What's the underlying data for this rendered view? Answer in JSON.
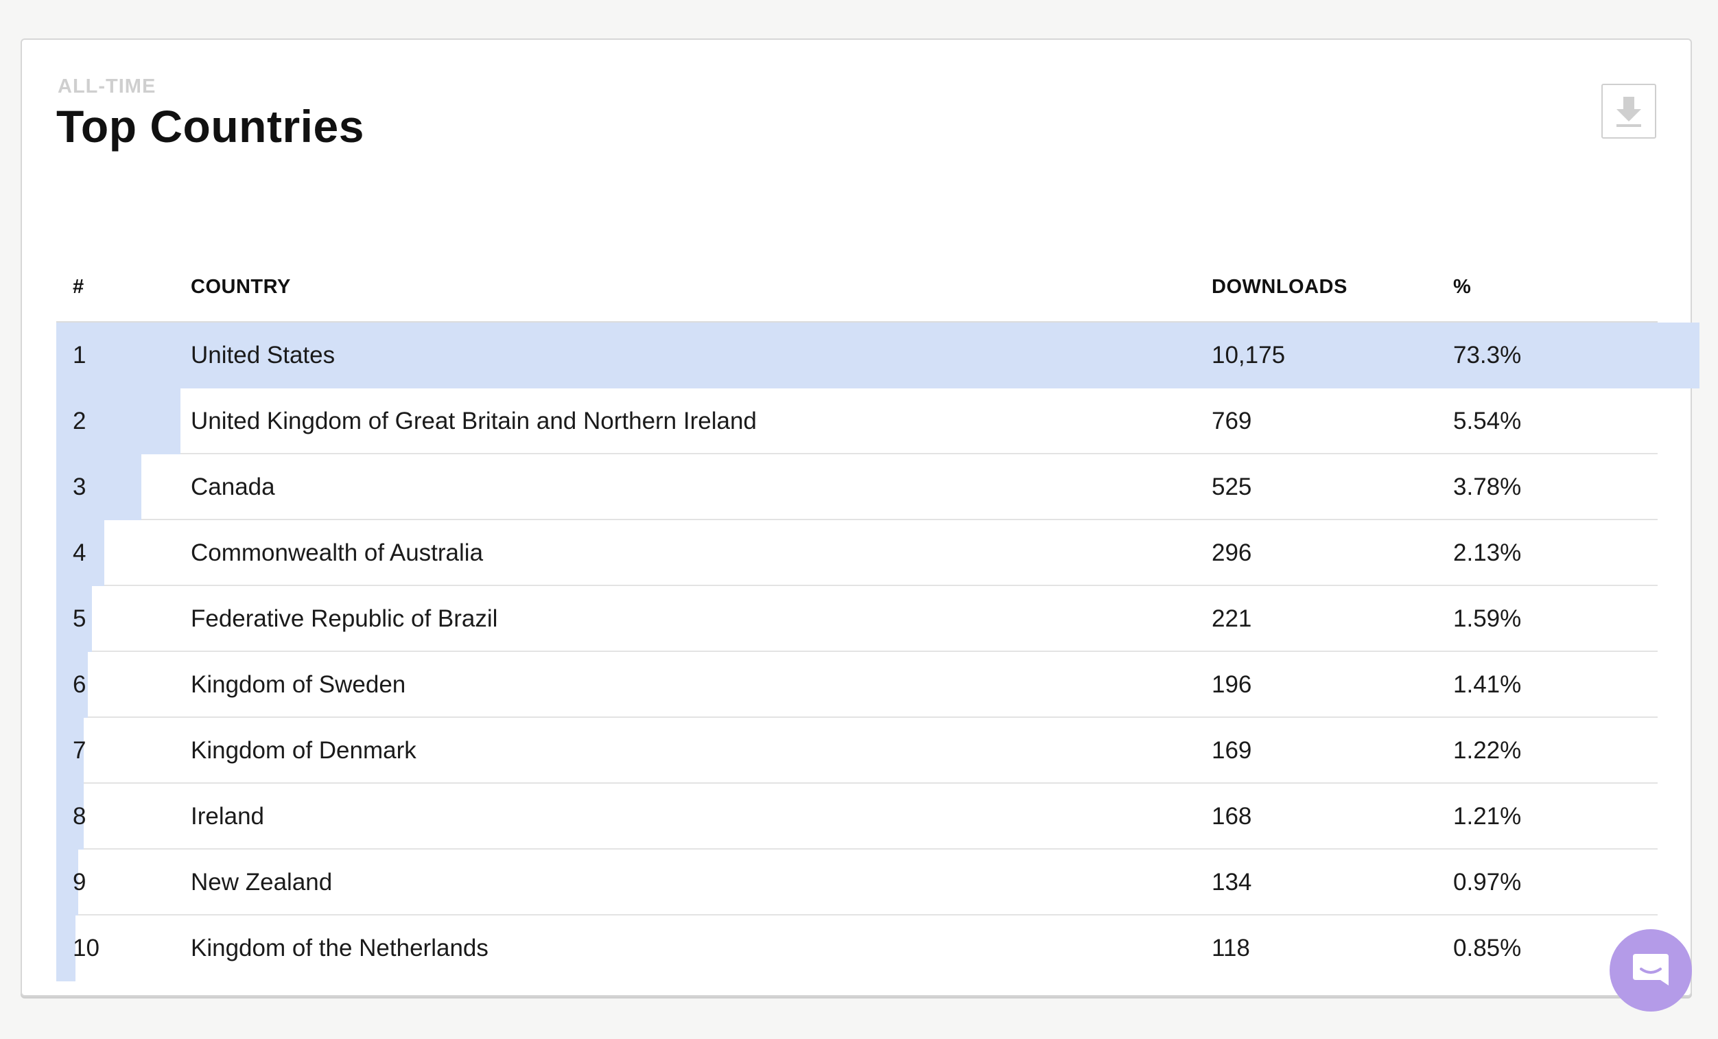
{
  "header": {
    "eyebrow": "ALL-TIME",
    "title": "Top Countries"
  },
  "table": {
    "columns": {
      "rank": "#",
      "country": "COUNTRY",
      "downloads": "DOWNLOADS",
      "percent": "%"
    },
    "rows": [
      {
        "rank": "1",
        "country": "United States",
        "downloads": "10,175",
        "percent": "73.3%",
        "share": 0.733
      },
      {
        "rank": "2",
        "country": "United Kingdom of Great Britain and Northern Ireland",
        "downloads": "769",
        "percent": "5.54%",
        "share": 0.0554
      },
      {
        "rank": "3",
        "country": "Canada",
        "downloads": "525",
        "percent": "3.78%",
        "share": 0.0378
      },
      {
        "rank": "4",
        "country": "Commonwealth of Australia",
        "downloads": "296",
        "percent": "2.13%",
        "share": 0.0213
      },
      {
        "rank": "5",
        "country": "Federative Republic of Brazil",
        "downloads": "221",
        "percent": "1.59%",
        "share": 0.0159
      },
      {
        "rank": "6",
        "country": "Kingdom of Sweden",
        "downloads": "196",
        "percent": "1.41%",
        "share": 0.0141
      },
      {
        "rank": "7",
        "country": "Kingdom of Denmark",
        "downloads": "169",
        "percent": "1.22%",
        "share": 0.0122
      },
      {
        "rank": "8",
        "country": "Ireland",
        "downloads": "168",
        "percent": "1.21%",
        "share": 0.0121
      },
      {
        "rank": "9",
        "country": "New Zealand",
        "downloads": "134",
        "percent": "0.97%",
        "share": 0.0097
      },
      {
        "rank": "10",
        "country": "Kingdom of the Netherlands",
        "downloads": "118",
        "percent": "0.85%",
        "share": 0.0085
      }
    ]
  },
  "icons": {
    "download": "download-icon",
    "chat": "chat-icon"
  },
  "colors": {
    "bar": "#d3e0f7",
    "chat_button": "#b49be8"
  }
}
